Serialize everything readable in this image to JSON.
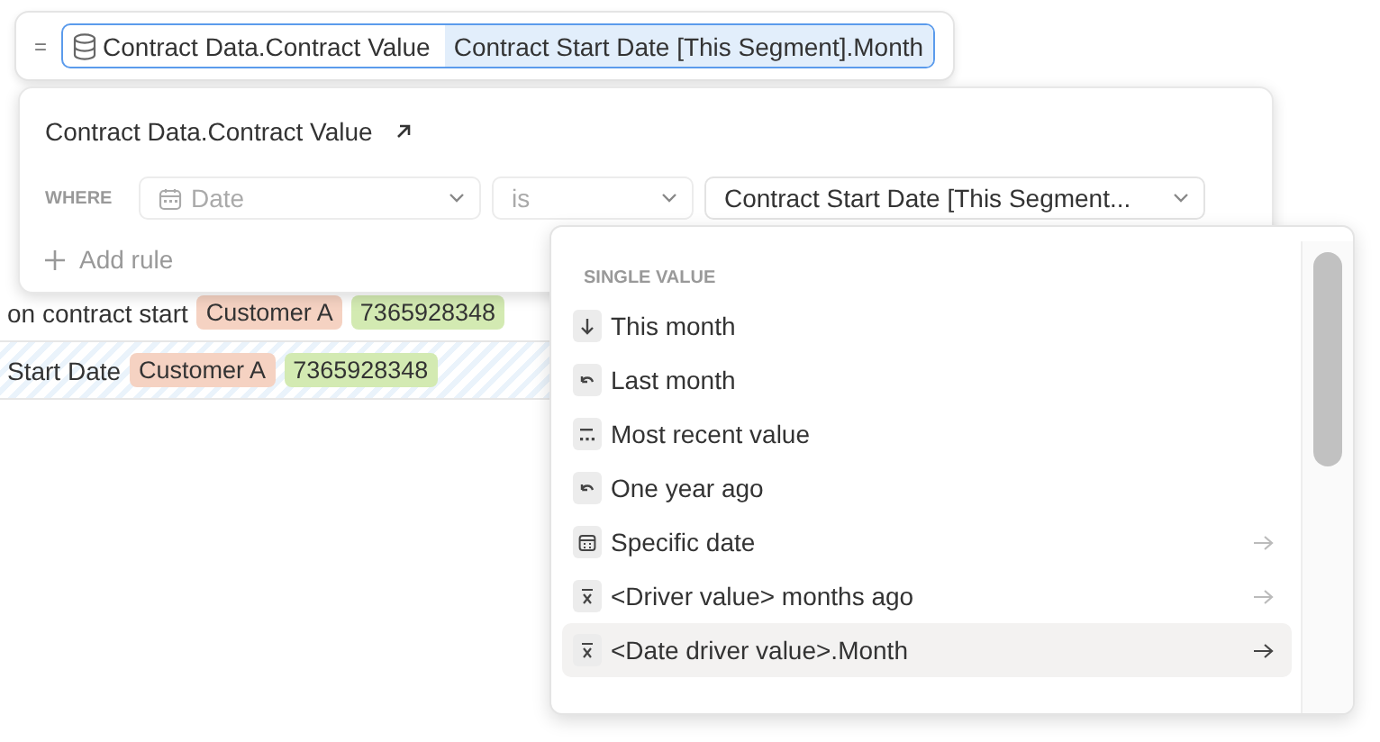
{
  "formula": {
    "operator": "=",
    "reference": "Contract Data.Contract Value",
    "argument": "Contract Start Date [This Segment].Month"
  },
  "rows": [
    {
      "text": "on contract start",
      "selected": false,
      "tags": [
        {
          "label": "Customer A",
          "color": "#f5d2c2"
        },
        {
          "label": "7365928348",
          "color": "#d3eab2"
        }
      ]
    },
    {
      "text": "Start Date",
      "selected": true,
      "tags": [
        {
          "label": "Customer A",
          "color": "#f5d2c2"
        },
        {
          "label": "7365928348",
          "color": "#d3eab2"
        }
      ]
    }
  ],
  "popover": {
    "title": "Contract Data.Contract Value",
    "where_label": "WHERE",
    "filters": [
      {
        "value": "Date",
        "disabled": true
      },
      {
        "value": "is",
        "disabled": true
      },
      {
        "value": "Contract Start Date [This Segment...",
        "disabled": false
      }
    ],
    "add_rule": "Add rule"
  },
  "menu": {
    "section": "SINGLE VALUE",
    "items": [
      {
        "label": "This month",
        "kind": "current",
        "submenu": false,
        "selected": false
      },
      {
        "label": "Last month",
        "kind": "previous",
        "submenu": false,
        "selected": false
      },
      {
        "label": "Most recent value",
        "kind": "latest",
        "submenu": false,
        "selected": false
      },
      {
        "label": "One year ago",
        "kind": "previous",
        "submenu": false,
        "selected": false
      },
      {
        "label": "Specific date",
        "kind": "date",
        "submenu": true,
        "selected": false
      },
      {
        "label": "<Driver value> months ago",
        "kind": "driver",
        "submenu": true,
        "selected": false
      },
      {
        "label": "<Date driver value>.Month",
        "kind": "driver",
        "submenu": true,
        "selected": true
      }
    ]
  }
}
